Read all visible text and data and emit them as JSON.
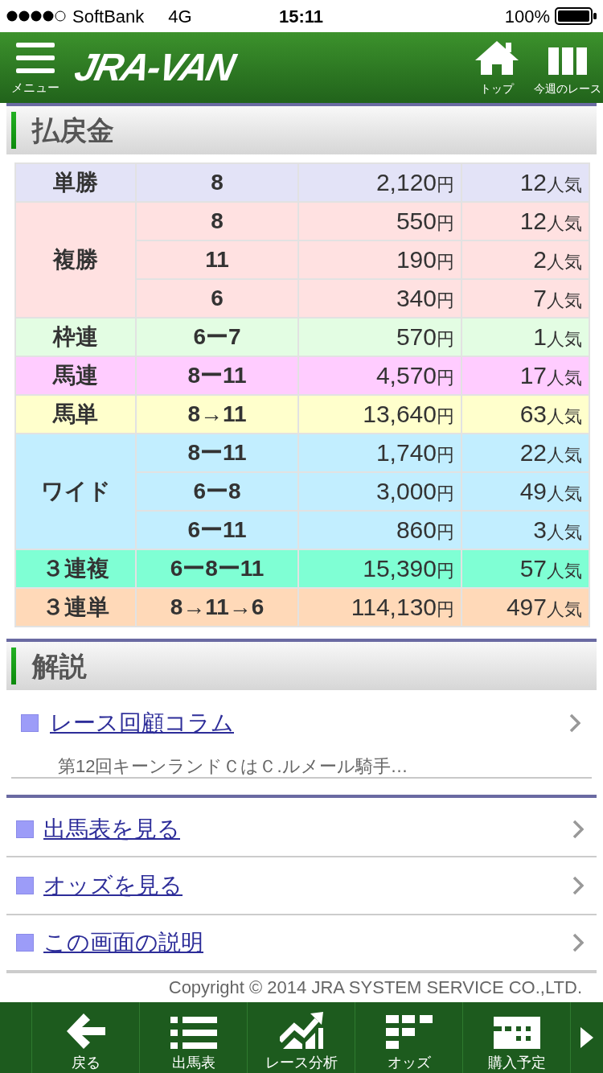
{
  "status_bar": {
    "carrier": "SoftBank",
    "network": "4G",
    "time": "15:11",
    "battery": "100%"
  },
  "header": {
    "menu_label": "メニュー",
    "logo": "JRA-VAN",
    "actions": [
      {
        "kind": "home",
        "label": "トップ"
      },
      {
        "kind": "columns",
        "label": "今週のレース"
      }
    ]
  },
  "payouts": {
    "title": "払戻金",
    "bets": [
      {
        "type": "単勝",
        "color": "#e3e3f7",
        "results": [
          {
            "combination": "8",
            "payout": "2,120",
            "payout_unit": "円",
            "popularity": "12",
            "popularity_unit": "人気"
          }
        ]
      },
      {
        "type": "複勝",
        "color": "#ffe1e1",
        "results": [
          {
            "combination": "8",
            "payout": "550",
            "payout_unit": "円",
            "popularity": "12",
            "popularity_unit": "人気"
          },
          {
            "combination": "11",
            "payout": "190",
            "payout_unit": "円",
            "popularity": "2",
            "popularity_unit": "人気"
          },
          {
            "combination": "6",
            "payout": "340",
            "payout_unit": "円",
            "popularity": "7",
            "popularity_unit": "人気"
          }
        ]
      },
      {
        "type": "枠連",
        "color": "#e3fde3",
        "results": [
          {
            "combination": "6ー7",
            "payout": "570",
            "payout_unit": "円",
            "popularity": "1",
            "popularity_unit": "人気"
          }
        ]
      },
      {
        "type": "馬連",
        "color": "#ffccff",
        "results": [
          {
            "combination": "8ー11",
            "payout": "4,570",
            "payout_unit": "円",
            "popularity": "17",
            "popularity_unit": "人気"
          }
        ]
      },
      {
        "type": "馬単",
        "color": "#ffffcc",
        "results": [
          {
            "combination": "8→11",
            "payout": "13,640",
            "payout_unit": "円",
            "popularity": "63",
            "popularity_unit": "人気"
          }
        ]
      },
      {
        "type": "ワイド",
        "color": "#c2eeff",
        "results": [
          {
            "combination": "8ー11",
            "payout": "1,740",
            "payout_unit": "円",
            "popularity": "22",
            "popularity_unit": "人気"
          },
          {
            "combination": "6ー8",
            "payout": "3,000",
            "payout_unit": "円",
            "popularity": "49",
            "popularity_unit": "人気"
          },
          {
            "combination": "6ー11",
            "payout": "860",
            "payout_unit": "円",
            "popularity": "3",
            "popularity_unit": "人気"
          }
        ]
      },
      {
        "type": "３連複",
        "color": "#7fffd4",
        "results": [
          {
            "combination": "6ー8ー11",
            "payout": "15,390",
            "payout_unit": "円",
            "popularity": "57",
            "popularity_unit": "人気"
          }
        ]
      },
      {
        "type": "３連単",
        "color": "#ffd9b8",
        "results": [
          {
            "combination": "8→11→6",
            "payout": "114,130",
            "payout_unit": "円",
            "popularity": "497",
            "popularity_unit": "人気"
          }
        ]
      }
    ]
  },
  "commentary": {
    "title": "解説",
    "items": [
      {
        "label": "レース回顧コラム",
        "summary": "第12回キーンランドＣはＣ.ルメール騎手…"
      }
    ]
  },
  "links": [
    {
      "label": "出馬表を見る"
    },
    {
      "label": "オッズを見る"
    },
    {
      "label": "この画面の説明"
    }
  ],
  "copyright": "Copyright © 2014 JRA SYSTEM SERVICE CO.,LTD.",
  "bottom_nav": {
    "items": [
      {
        "kind": "back",
        "label": "戻る"
      },
      {
        "kind": "list",
        "label": "出馬表"
      },
      {
        "kind": "analysis",
        "label": "レース分析"
      },
      {
        "kind": "odds",
        "label": "オッズ"
      },
      {
        "kind": "plan",
        "label": "購入予定"
      }
    ]
  }
}
